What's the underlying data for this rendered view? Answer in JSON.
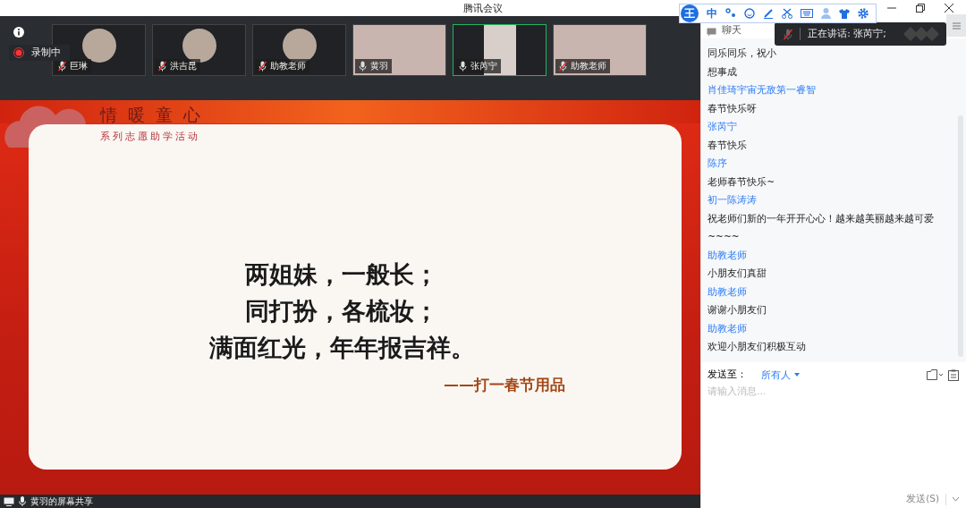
{
  "window": {
    "title": "腾讯会议"
  },
  "recording": {
    "label": "录制中"
  },
  "participants": [
    {
      "name": "巨琳",
      "kind": "avatar",
      "muted": true,
      "selected": false
    },
    {
      "name": "洪吉昆",
      "kind": "avatar",
      "muted": true,
      "selected": false
    },
    {
      "name": "助教老师",
      "kind": "avatar",
      "muted": true,
      "selected": false
    },
    {
      "name": "黄羽",
      "kind": "video",
      "muted": false,
      "selected": false
    },
    {
      "name": "张芮宁",
      "kind": "video",
      "muted": false,
      "selected": true
    },
    {
      "name": "助教老师",
      "kind": "video",
      "muted": true,
      "selected": false
    }
  ],
  "slide": {
    "title": "情暖童心",
    "subtitle": "系列志愿助学活动",
    "lines": [
      "两姐妹，一般长；",
      "同打扮，各梳妆；",
      "满面红光，年年报吉祥。"
    ],
    "answer": "——打一春节用品"
  },
  "share_bar": {
    "label": "黄羽的屏幕共享"
  },
  "ime_toolbar": {
    "logo": "王",
    "mode": "中"
  },
  "chat": {
    "title": "聊天",
    "speaking": "正在讲话: 张芮宁;",
    "messages": [
      {
        "kind": "text",
        "text": "同乐同乐，祝小"
      },
      {
        "kind": "text",
        "text": "想事成"
      },
      {
        "kind": "sender",
        "text": "肖佳琦宇宙无敌第一睿智"
      },
      {
        "kind": "text",
        "text": "春节快乐呀"
      },
      {
        "kind": "sender",
        "text": "张芮宁"
      },
      {
        "kind": "text",
        "text": "春节快乐"
      },
      {
        "kind": "sender",
        "text": "陈序"
      },
      {
        "kind": "text",
        "text": "老师春节快乐~"
      },
      {
        "kind": "sender",
        "text": "初一陈涛涛"
      },
      {
        "kind": "text",
        "text": "祝老师们新的一年开开心心！越来越美丽越来越可爱"
      },
      {
        "kind": "text",
        "text": "~~~~"
      },
      {
        "kind": "sender",
        "text": "助教老师"
      },
      {
        "kind": "text",
        "text": "小朋友们真甜"
      },
      {
        "kind": "sender",
        "text": "助教老师"
      },
      {
        "kind": "text",
        "text": "谢谢小朋友们"
      },
      {
        "kind": "sender",
        "text": "助教老师"
      },
      {
        "kind": "text",
        "text": "欢迎小朋友们积极互动"
      }
    ],
    "send_to_label": "发送至：",
    "recipient": "所有人",
    "placeholder": "请输入消息...",
    "send": "发送(S)"
  }
}
